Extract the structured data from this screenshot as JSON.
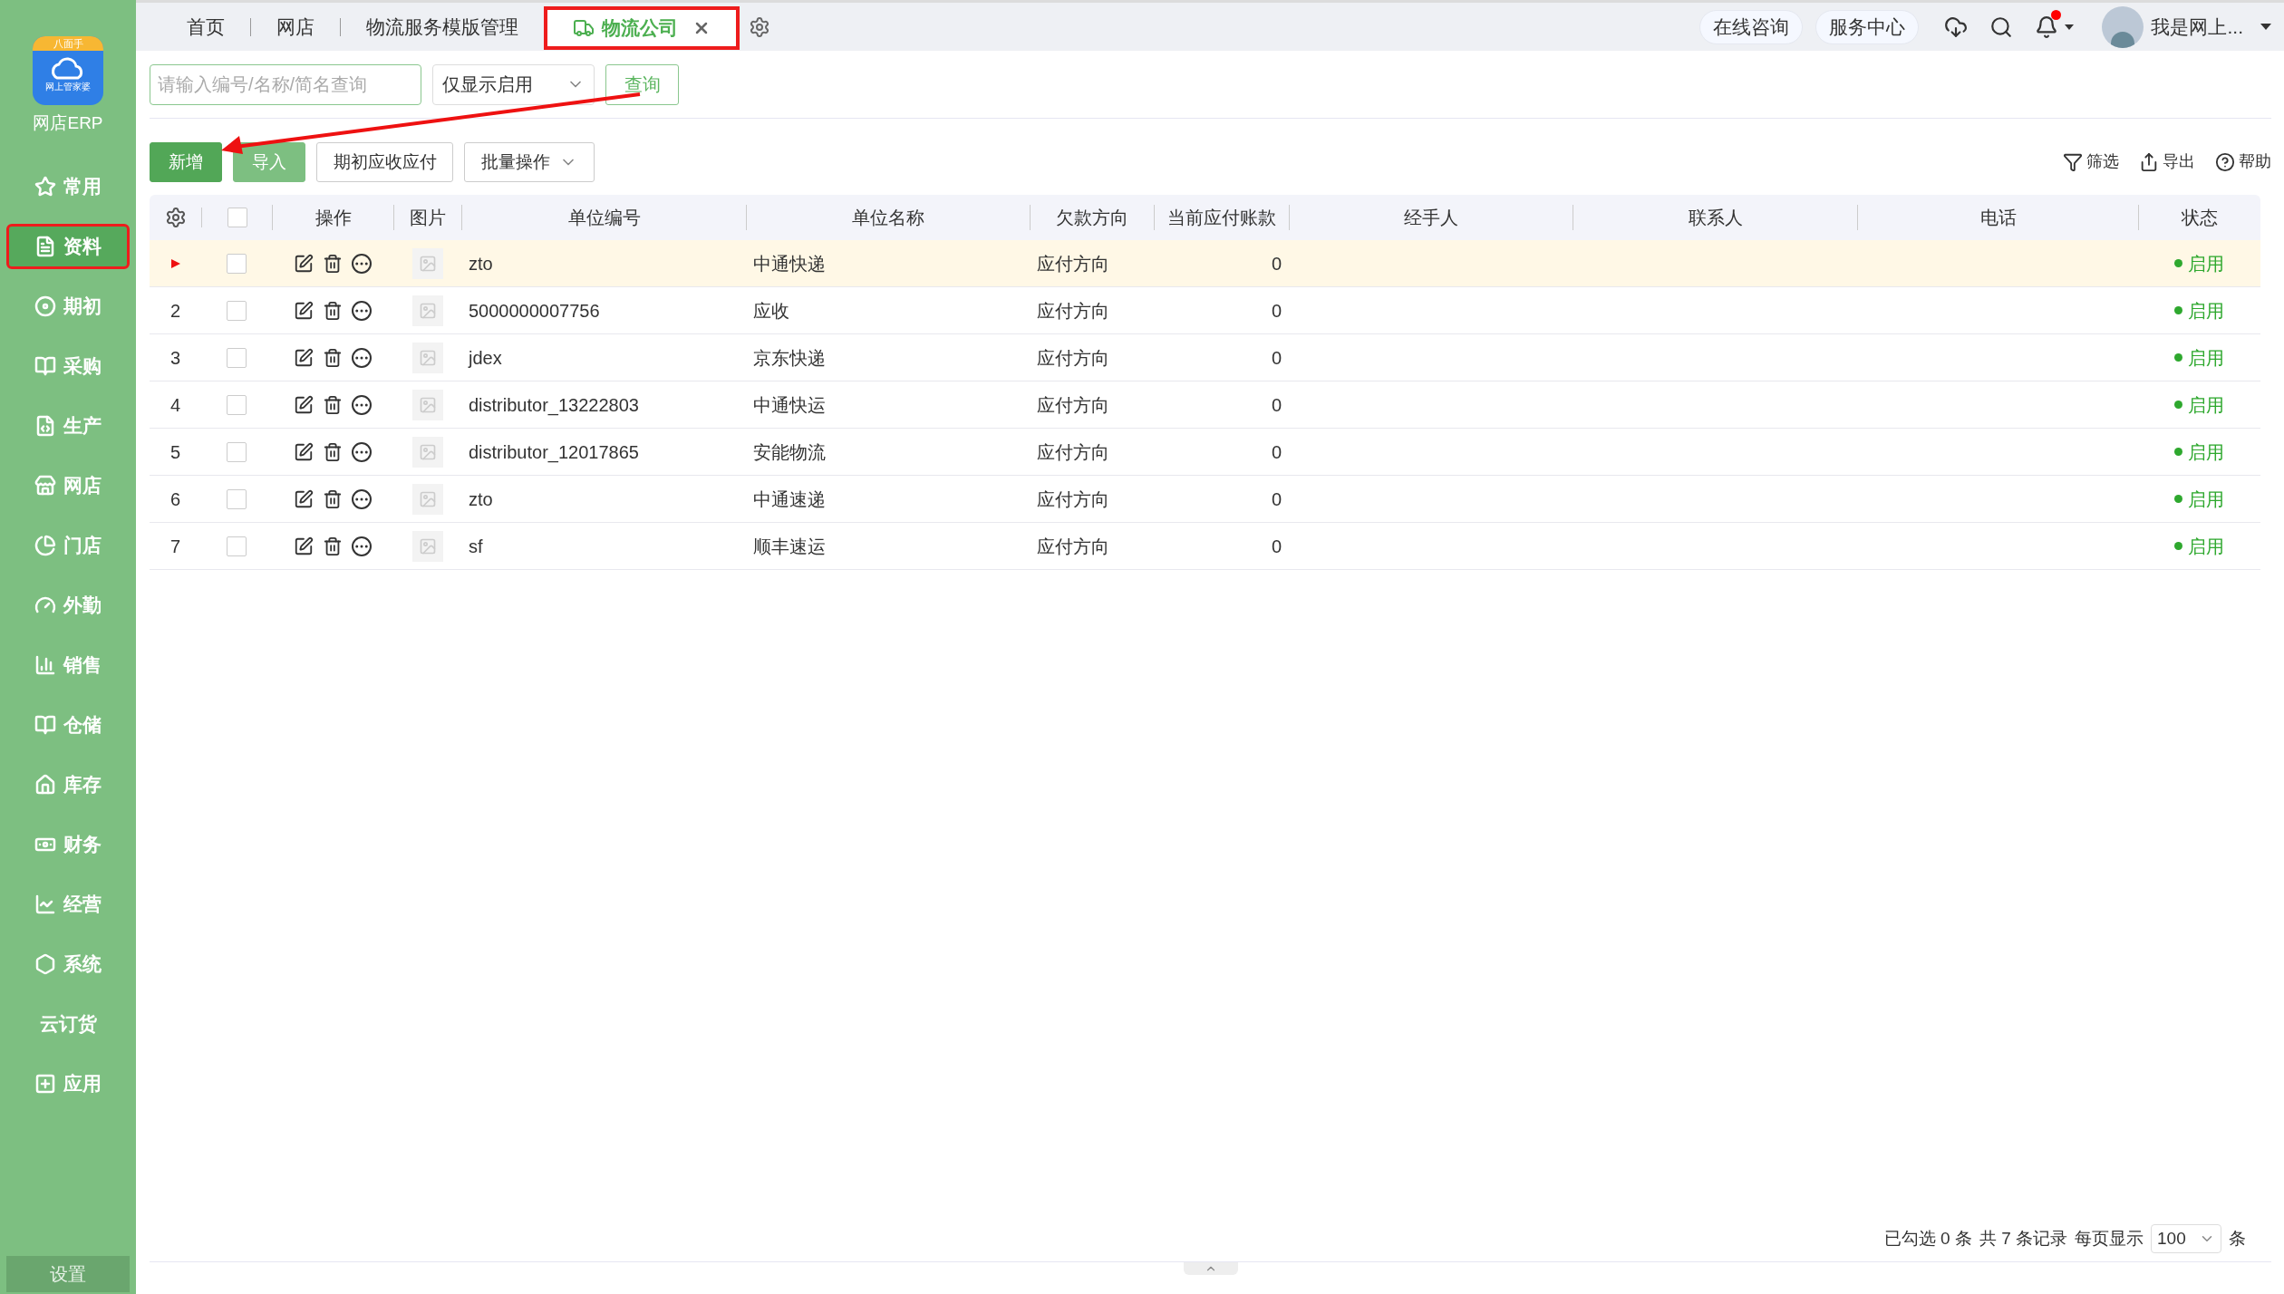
{
  "app": {
    "logo_banner": "八面手",
    "logo_caption": "网上管家婆",
    "name": "网店ERP"
  },
  "sidebar": {
    "items": [
      {
        "label": "常用",
        "selected": false,
        "highlighted": false
      },
      {
        "label": "资料",
        "selected": true,
        "highlighted": true
      },
      {
        "label": "期初",
        "selected": false,
        "highlighted": false
      },
      {
        "label": "采购",
        "selected": false,
        "highlighted": false
      },
      {
        "label": "生产",
        "selected": false,
        "highlighted": false
      },
      {
        "label": "网店",
        "selected": false,
        "highlighted": false
      },
      {
        "label": "门店",
        "selected": false,
        "highlighted": false
      },
      {
        "label": "外勤",
        "selected": false,
        "highlighted": false
      },
      {
        "label": "销售",
        "selected": false,
        "highlighted": false
      },
      {
        "label": "仓储",
        "selected": false,
        "highlighted": false
      },
      {
        "label": "库存",
        "selected": false,
        "highlighted": false
      },
      {
        "label": "财务",
        "selected": false,
        "highlighted": false
      },
      {
        "label": "经营",
        "selected": false,
        "highlighted": false
      },
      {
        "label": "系统",
        "selected": false,
        "highlighted": false
      },
      {
        "label": "云订货",
        "selected": false,
        "highlighted": false
      },
      {
        "label": "应用",
        "selected": false,
        "highlighted": false
      }
    ],
    "settings": "设置"
  },
  "tabs": [
    {
      "label": "首页",
      "selected": false,
      "closable": false,
      "highlighted": false
    },
    {
      "label": "网店",
      "selected": false,
      "closable": false,
      "highlighted": false
    },
    {
      "label": "物流服务模版管理",
      "selected": false,
      "closable": false,
      "highlighted": false
    },
    {
      "label": "物流公司",
      "selected": true,
      "closable": true,
      "highlighted": true
    }
  ],
  "header": {
    "consult": "在线咨询",
    "service": "服务中心",
    "notification_dot": true,
    "user": "我是网上..."
  },
  "search": {
    "placeholder": "请输入编号/名称/简名查询",
    "filter": "仅显示启用",
    "query": "查询"
  },
  "actions": [
    {
      "label": "新增",
      "kind": "primary"
    },
    {
      "label": "导入",
      "kind": "secondary"
    },
    {
      "label": "期初应收应付",
      "kind": "outline"
    },
    {
      "label": "批量操作",
      "kind": "dropdown"
    }
  ],
  "tools": [
    {
      "label": "筛选"
    },
    {
      "label": "导出"
    },
    {
      "label": "帮助"
    }
  ],
  "table": {
    "header_checked": false,
    "columns": [
      "操作",
      "图片",
      "单位编号",
      "单位名称",
      "欠款方向",
      "当前应付账款",
      "经手人",
      "联系人",
      "电话",
      "状态"
    ],
    "rows": [
      {
        "selected": true,
        "checked": false,
        "code": "zto",
        "name": "中通快递",
        "direction": "应付方向",
        "payable": "0",
        "status": "启用",
        "enabled": true
      },
      {
        "index": "2",
        "selected": false,
        "checked": false,
        "code": "5000000007756",
        "name": "应收",
        "direction": "应付方向",
        "payable": "0",
        "status": "启用",
        "enabled": true
      },
      {
        "index": "3",
        "selected": false,
        "checked": false,
        "code": "jdex",
        "name": "京东快递",
        "direction": "应付方向",
        "payable": "0",
        "status": "启用",
        "enabled": true
      },
      {
        "index": "4",
        "selected": false,
        "checked": false,
        "code": "distributor_13222803",
        "name": "中通快运",
        "direction": "应付方向",
        "payable": "0",
        "status": "启用",
        "enabled": true
      },
      {
        "index": "5",
        "selected": false,
        "checked": false,
        "code": "distributor_12017865",
        "name": "安能物流",
        "direction": "应付方向",
        "payable": "0",
        "status": "启用",
        "enabled": true
      },
      {
        "index": "6",
        "selected": false,
        "checked": false,
        "code": "zto",
        "name": "中通速递",
        "direction": "应付方向",
        "payable": "0",
        "status": "启用",
        "enabled": true
      },
      {
        "index": "7",
        "selected": false,
        "checked": false,
        "code": "sf",
        "name": "顺丰速运",
        "direction": "应付方向",
        "payable": "0",
        "status": "启用",
        "enabled": true
      }
    ]
  },
  "pagination": {
    "selected_text": "已勾选 0 条",
    "total_text": "共 7 条记录",
    "per_page_label": "每页显示",
    "per_page": "100",
    "unit": "条"
  }
}
